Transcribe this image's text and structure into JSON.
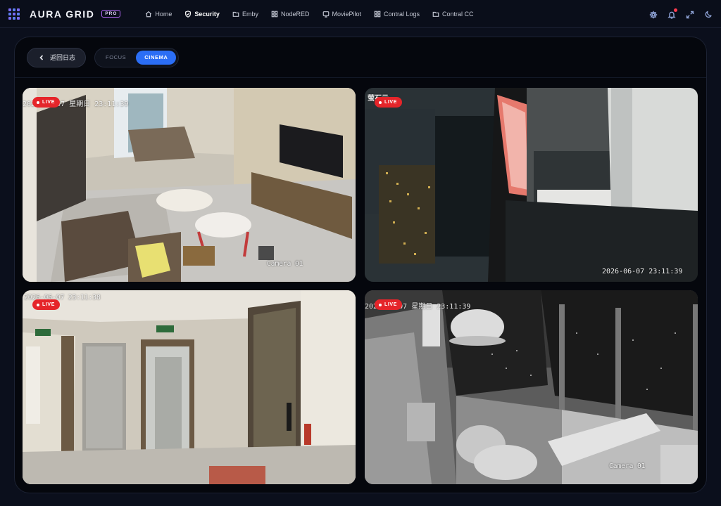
{
  "app": {
    "brand": "AURA GRID",
    "badge": "PRO",
    "accent_color": "#2b6ef5",
    "live_color": "#e5252a"
  },
  "nav": {
    "items": [
      {
        "label": "Home",
        "icon": "home-icon"
      },
      {
        "label": "Security",
        "icon": "shield-icon",
        "active": true
      },
      {
        "label": "Emby",
        "icon": "folder-icon"
      },
      {
        "label": "NodeRED",
        "icon": "grid-icon"
      },
      {
        "label": "MoviePilot",
        "icon": "tv-icon"
      },
      {
        "label": "Contral Logs",
        "icon": "grid-icon"
      },
      {
        "label": "Contral CC",
        "icon": "folder-icon"
      }
    ]
  },
  "top_actions": [
    "gear-icon",
    "bell-icon",
    "expand-icon",
    "moon-icon"
  ],
  "header": {
    "back_label": "返回日志",
    "modes": [
      {
        "label": "FOCUS",
        "active": false
      },
      {
        "label": "CINEMA",
        "active": true
      }
    ]
  },
  "cameras": [
    {
      "live_label": "LIVE",
      "osd_datetime": "2026-06-07 星期日 23:11:39",
      "osd_name": "Camera 01"
    },
    {
      "live_label": "LIVE",
      "osd_brand": "萤石云",
      "osd_datetime": "2026-06-07 23:11:39"
    },
    {
      "live_label": "LIVE",
      "osd_datetime": "2026-06-07 23:11:38"
    },
    {
      "live_label": "LIVE",
      "osd_datetime": "2026-06-07 星期日 23:11:39",
      "osd_name": "Camera 01"
    }
  ]
}
